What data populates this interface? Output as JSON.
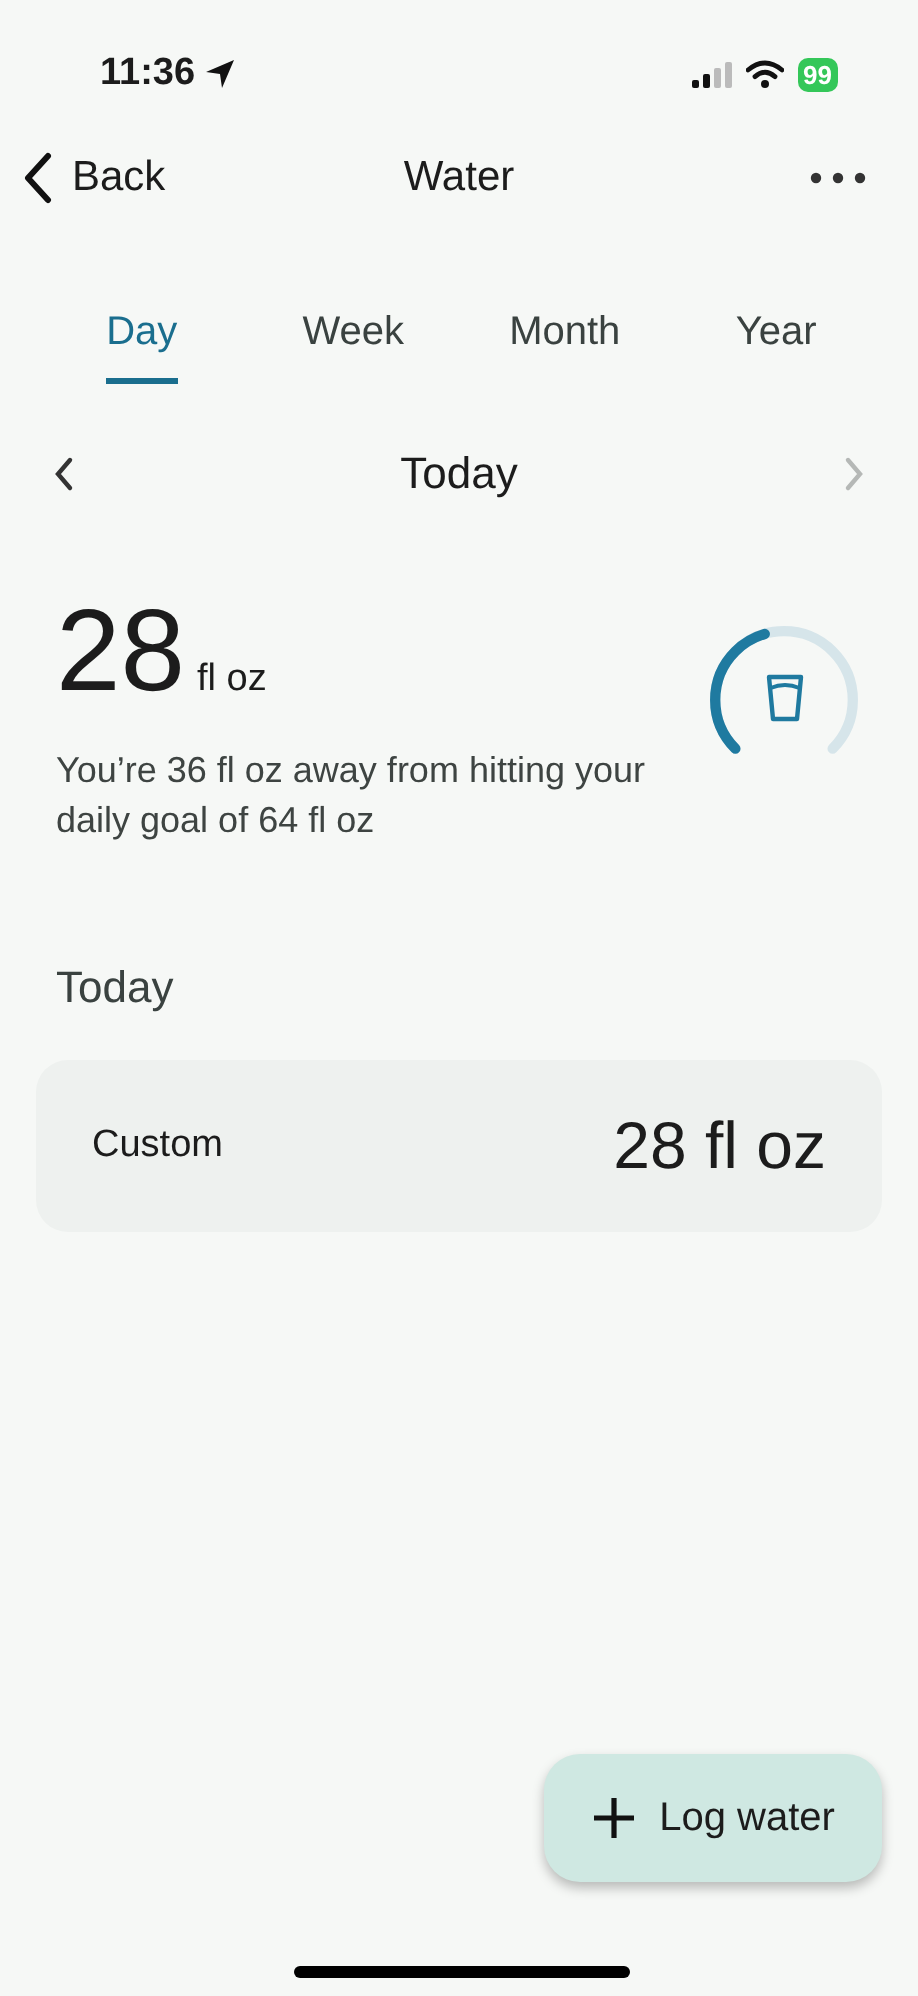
{
  "status_bar": {
    "time": "11:36",
    "battery": "99"
  },
  "nav": {
    "back": "Back",
    "title": "Water"
  },
  "tabs": [
    {
      "label": "Day",
      "selected": true
    },
    {
      "label": "Week",
      "selected": false
    },
    {
      "label": "Month",
      "selected": false
    },
    {
      "label": "Year",
      "selected": false
    }
  ],
  "date_nav": {
    "label": "Today",
    "next_disabled": true
  },
  "summary": {
    "amount": "28",
    "unit": "fl oz",
    "message": "You’re 36 fl oz away from hitting your daily goal of 64 fl oz"
  },
  "section_title": "Today",
  "entries": [
    {
      "name": "Custom",
      "amount": "28 fl oz"
    }
  ],
  "fab": {
    "label": "Log water"
  }
}
